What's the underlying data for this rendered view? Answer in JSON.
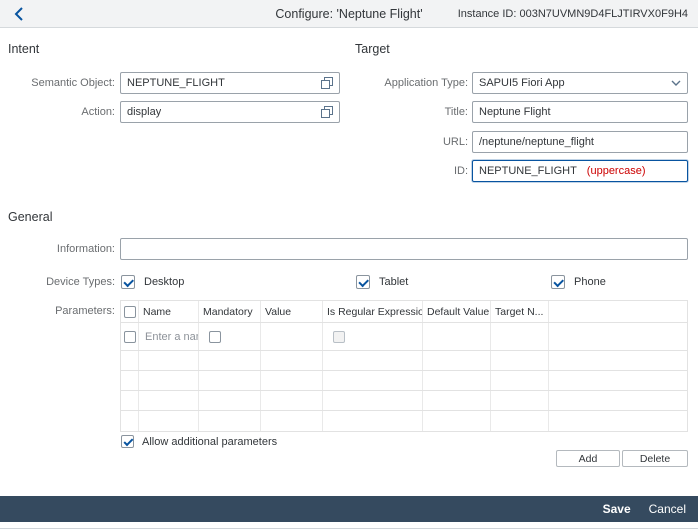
{
  "header": {
    "title": "Configure: 'Neptune Flight'",
    "instance_id": "Instance ID: 003N7UVMN9D4FLJTIRVX0F9H4"
  },
  "intent": {
    "section_title": "Intent",
    "semantic_object": {
      "label": "Semantic Object:",
      "value": "NEPTUNE_FLIGHT"
    },
    "action": {
      "label": "Action:",
      "value": "display"
    }
  },
  "target": {
    "section_title": "Target",
    "application_type": {
      "label": "Application Type:",
      "value": "SAPUI5 Fiori App"
    },
    "title_field": {
      "label": "Title:",
      "value": "Neptune Flight"
    },
    "url": {
      "label": "URL:",
      "value": "/neptune/neptune_flight"
    },
    "id": {
      "label": "ID:",
      "value": "NEPTUNE_FLIGHT",
      "hint": "(uppercase)"
    }
  },
  "general": {
    "section_title": "General",
    "information": {
      "label": "Information:",
      "value": ""
    },
    "device_types": {
      "label": "Device Types:",
      "options": [
        {
          "label": "Desktop",
          "checked": true
        },
        {
          "label": "Tablet",
          "checked": true
        },
        {
          "label": "Phone",
          "checked": true
        }
      ]
    },
    "parameters": {
      "label": "Parameters:",
      "columns": [
        "Name",
        "Mandatory",
        "Value",
        "Is Regular Expression",
        "Default Value",
        "Target N..."
      ],
      "first_row_placeholder": "Enter a nam",
      "empty_rows": 4,
      "allow_additional_label": "Allow additional parameters",
      "allow_additional_checked": true,
      "add_button": "Add",
      "delete_button": "Delete"
    }
  },
  "footer": {
    "save_label": "Save",
    "cancel_label": "Cancel"
  },
  "colors": {
    "accent_blue": "#0854a0",
    "footer_bg": "#354a5f",
    "hint_red": "#cc0000",
    "header_bg": "#f2f3f4"
  }
}
